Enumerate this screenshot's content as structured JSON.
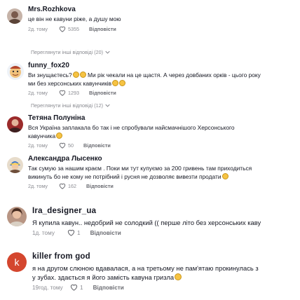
{
  "comments": [
    {
      "username": "Mrs.Rozhkova",
      "text": "це він не кавуни ріже, а душу мою",
      "time": "2д. тому",
      "likes": "5355",
      "reply": "Відповісти",
      "more_replies": "Переглянути інші відповіді (20)"
    },
    {
      "username": "funny_fox20",
      "text_a": "Ви знущаєтесь?",
      "text_b": " Ми рік чекали на це щастя. А через довбаних орків - цього року\nми без херсонських кавунчиків",
      "time": "2д. тому",
      "likes": "1293",
      "reply": "Відповісти",
      "more_replies": "Переглянути інші відповіді (12)"
    },
    {
      "username": "Тетяна Полуніна",
      "text": "Вся Україна заплакала бо так і не спробували найсмачнішого Херсонського\nкавунчика",
      "time": "2д. тому",
      "likes": "50",
      "reply": "Відповісти"
    },
    {
      "username": "Александра Лысенко",
      "text": "Так сумую за нашим краєм . Поки ми тут купуємо за 200 гривень там приходиться\nвикинуть бо не кому не потрібний і русня не дозволяє вивезти продати",
      "time": "2д. тому",
      "likes": "162",
      "reply": "Відповісти"
    },
    {
      "username": "Ira_designer_ua",
      "text": "Я купила кавун.. недобрий не солодкий (( перше літо без херсонських каву",
      "time": "1д. тому",
      "likes": "1",
      "reply": "Відповісти"
    },
    {
      "username": "killer from god",
      "avatar_letter": "k",
      "text": "я на другом слюною вдавалася, а на третьому не пам'ятаю прокинулась з\nу зубах. здається я його замість кавуна гризла",
      "time": "19год. тому",
      "likes": "1",
      "reply": "Відповісти"
    }
  ],
  "colors": {
    "text": "#161823",
    "secondary": "#8a8b91",
    "avatar_k": "#d4462e"
  }
}
